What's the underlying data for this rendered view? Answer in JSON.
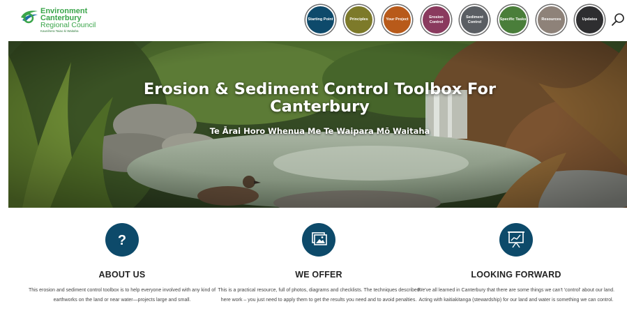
{
  "logo": {
    "line1": "Environment",
    "line2": "Canterbury",
    "line3": "Regional Council",
    "line4": "Kaunihera Taiao ki Waitaha"
  },
  "nav": [
    {
      "label": "Starting Point",
      "color": "#0e4a6b"
    },
    {
      "label": "Principles",
      "color": "#7d7a2a"
    },
    {
      "label": "Your Project",
      "color": "#b85a1a"
    },
    {
      "label": "Erosion Control",
      "color": "#8a3a5e"
    },
    {
      "label": "Sediment Control",
      "color": "#5a5e63"
    },
    {
      "label": "Specific Tasks",
      "color": "#4a7e3a"
    },
    {
      "label": "Resources",
      "color": "#8e8279"
    },
    {
      "label": "Updates",
      "color": "#2e2e30"
    }
  ],
  "hero": {
    "title_line1": "Erosion & Sediment Control Toolbox For",
    "title_line2": "Canterbury",
    "subtitle": "Te Ārai Horo Whenua Me Te Waipara Mō Waitaha"
  },
  "features": [
    {
      "icon": "question-icon",
      "title": "ABOUT US",
      "text": "This erosion and sediment control toolbox is to help everyone involved with any kind of earthworks on the land or near water—projects large and small."
    },
    {
      "icon": "photos-icon",
      "title": "WE OFFER",
      "text": "This is a practical resource, full of photos, diagrams and checklists. The techniques described here work – you just need to apply them to get the results you need and to avoid penalties."
    },
    {
      "icon": "presentation-chart-icon",
      "title": "LOOKING FORWARD",
      "text": "We've all learned in Canterbury that there are some things we can't 'control' about our land. Acting with kaitiakitanga (stewardship) for our land and water is something we can control."
    }
  ]
}
